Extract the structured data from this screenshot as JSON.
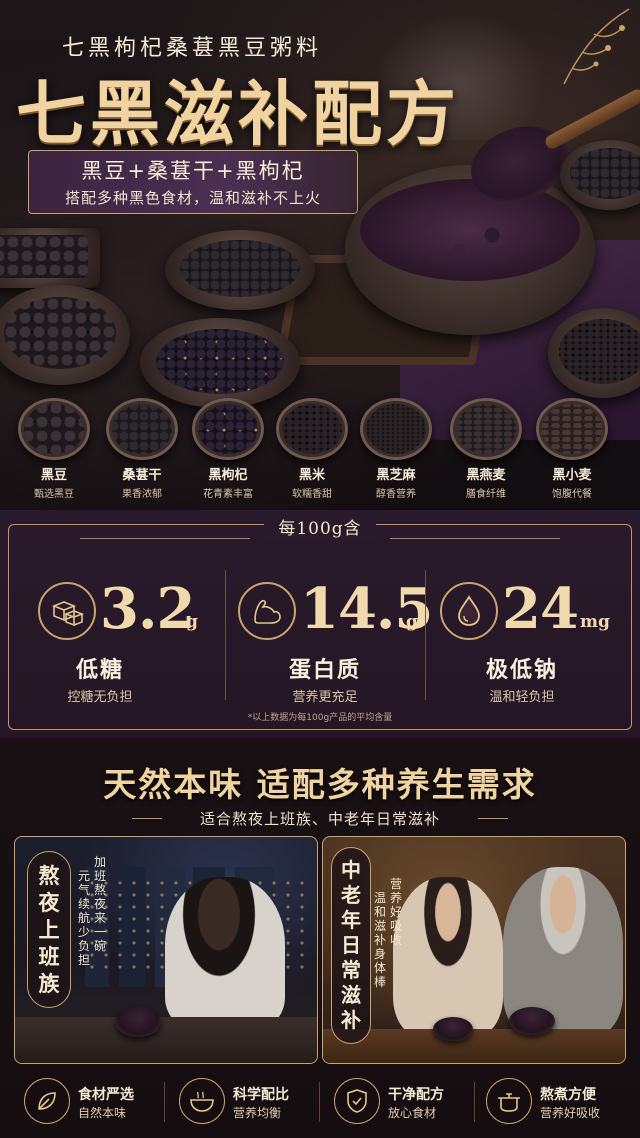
{
  "hero": {
    "subtitle": "七黑枸杞桑葚黑豆粥料",
    "title": "七黑滋补配方",
    "ribbon_top": "黑豆+桑葚干+黑枸杞",
    "ribbon_bottom": "搭配多种黑色食材，温和滋补不上火"
  },
  "ingredients": [
    {
      "name": "黑豆",
      "desc": "甄选黑豆",
      "icon": "black-bean"
    },
    {
      "name": "桑葚干",
      "desc": "果香浓郁",
      "icon": "mulberry"
    },
    {
      "name": "黑枸杞",
      "desc": "花青素丰富",
      "icon": "black-goji"
    },
    {
      "name": "黑米",
      "desc": "软糯香甜",
      "icon": "black-rice"
    },
    {
      "name": "黑芝麻",
      "desc": "醇香营养",
      "icon": "black-sesame"
    },
    {
      "name": "黑燕麦",
      "desc": "膳食纤维",
      "icon": "black-oat"
    },
    {
      "name": "黑小麦",
      "desc": "饱腹代餐",
      "icon": "black-wheat"
    }
  ],
  "nutrition": {
    "title": "每100g含",
    "stats": [
      {
        "value": "3.2",
        "unit": "g",
        "label": "低糖",
        "sub": "控糖无负担",
        "icon": "sugar-cube-icon"
      },
      {
        "value": "14.5",
        "unit": "g",
        "label": "蛋白质",
        "sub": "营养更充足",
        "icon": "muscle-icon"
      },
      {
        "value": "24",
        "unit": "mg",
        "label": "极低钠",
        "sub": "温和轻负担",
        "icon": "droplet-icon"
      }
    ],
    "note": "*以上数据为每100g产品的平均含量"
  },
  "scene": {
    "title": "天然本味  适配多种养生需求",
    "subtitle": "适合熬夜上班族、中老年日常滋补",
    "left_tag": [
      "熬",
      "夜",
      "上",
      "班",
      "族"
    ],
    "left_col1": [
      "加",
      "班",
      "熬",
      "夜",
      "来",
      "一",
      "碗"
    ],
    "left_col2": [
      "元",
      "气",
      "续",
      "航",
      "少",
      "负",
      "担"
    ],
    "right_tag": [
      "中",
      "老",
      "年",
      "日",
      "常",
      "滋",
      "补"
    ],
    "right_col1": [
      "营",
      "养",
      "好",
      "吸",
      "收"
    ],
    "right_col2": [
      "温",
      "和",
      "滋",
      "补",
      "身",
      "体",
      "棒"
    ]
  },
  "features": [
    {
      "title": "食材严选",
      "sub": "自然本味",
      "icon": "leaf-icon"
    },
    {
      "title": "科学配比",
      "sub": "营养均衡",
      "icon": "bowl-icon"
    },
    {
      "title": "干净配方",
      "sub": "放心食材",
      "icon": "shield-check-icon"
    },
    {
      "title": "熬煮方便",
      "sub": "营养好吸收",
      "icon": "pot-icon"
    }
  ],
  "colors": {
    "gold": "#c9a56b",
    "purple": "#2a1b2c",
    "background": "#120d10"
  }
}
